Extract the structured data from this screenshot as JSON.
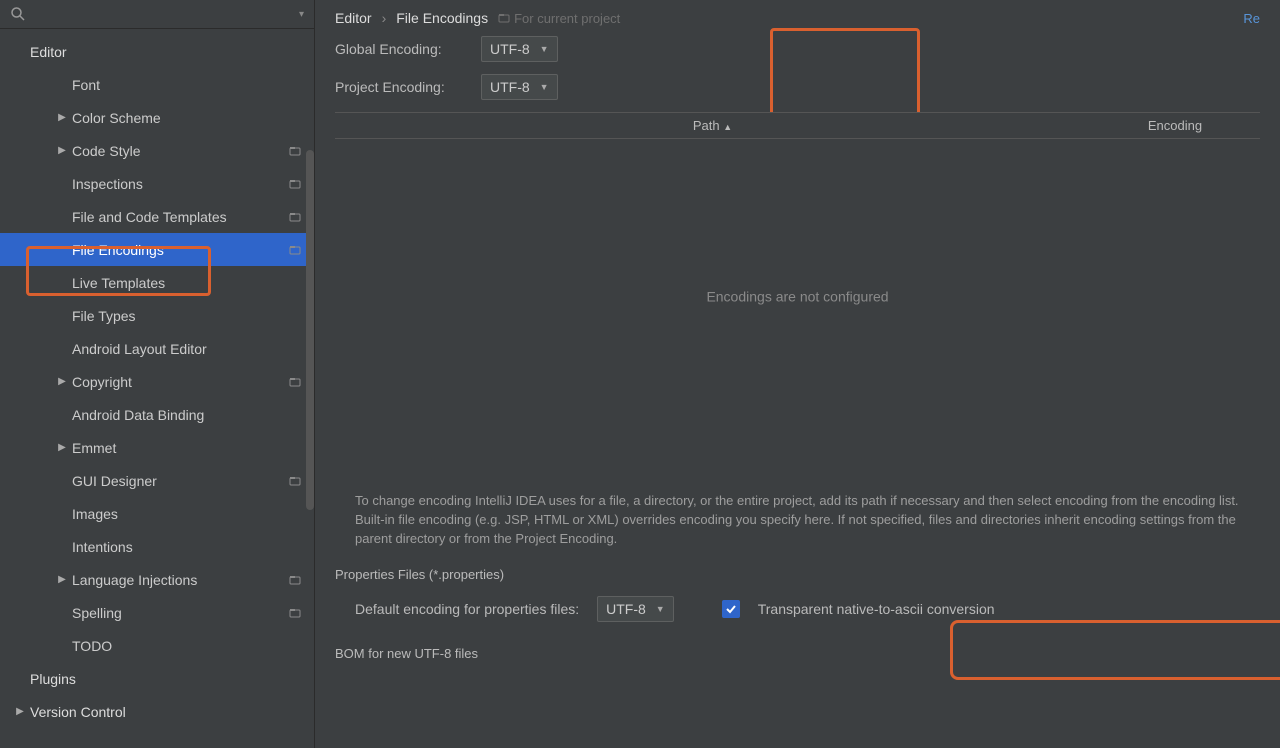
{
  "search": {
    "placeholder": ""
  },
  "sidebar": {
    "items": [
      {
        "label": "Editor",
        "depth": 0,
        "expander": "",
        "selected": false,
        "badge": false
      },
      {
        "label": "Font",
        "depth": 2,
        "expander": "",
        "selected": false,
        "badge": false
      },
      {
        "label": "Color Scheme",
        "depth": 2,
        "expander": "▶",
        "selected": false,
        "badge": false
      },
      {
        "label": "Code Style",
        "depth": 2,
        "expander": "▶",
        "selected": false,
        "badge": true
      },
      {
        "label": "Inspections",
        "depth": 2,
        "expander": "",
        "selected": false,
        "badge": true
      },
      {
        "label": "File and Code Templates",
        "depth": 2,
        "expander": "",
        "selected": false,
        "badge": true
      },
      {
        "label": "File Encodings",
        "depth": 2,
        "expander": "",
        "selected": true,
        "badge": true
      },
      {
        "label": "Live Templates",
        "depth": 2,
        "expander": "",
        "selected": false,
        "badge": false
      },
      {
        "label": "File Types",
        "depth": 2,
        "expander": "",
        "selected": false,
        "badge": false
      },
      {
        "label": "Android Layout Editor",
        "depth": 2,
        "expander": "",
        "selected": false,
        "badge": false
      },
      {
        "label": "Copyright",
        "depth": 2,
        "expander": "▶",
        "selected": false,
        "badge": true
      },
      {
        "label": "Android Data Binding",
        "depth": 2,
        "expander": "",
        "selected": false,
        "badge": false
      },
      {
        "label": "Emmet",
        "depth": 2,
        "expander": "▶",
        "selected": false,
        "badge": false
      },
      {
        "label": "GUI Designer",
        "depth": 2,
        "expander": "",
        "selected": false,
        "badge": true
      },
      {
        "label": "Images",
        "depth": 2,
        "expander": "",
        "selected": false,
        "badge": false
      },
      {
        "label": "Intentions",
        "depth": 2,
        "expander": "",
        "selected": false,
        "badge": false
      },
      {
        "label": "Language Injections",
        "depth": 2,
        "expander": "▶",
        "selected": false,
        "badge": true
      },
      {
        "label": "Spelling",
        "depth": 2,
        "expander": "",
        "selected": false,
        "badge": true
      },
      {
        "label": "TODO",
        "depth": 2,
        "expander": "",
        "selected": false,
        "badge": false
      },
      {
        "label": "Plugins",
        "depth": 0,
        "expander": "",
        "selected": false,
        "badge": false
      },
      {
        "label": "Version Control",
        "depth": 0,
        "expander": "▶",
        "selected": false,
        "badge": false
      }
    ]
  },
  "breadcrumb": {
    "a": "Editor",
    "b": "File Encodings",
    "hint": "For current project",
    "reset": "Re"
  },
  "form": {
    "global_label": "Global Encoding:",
    "global_value": "UTF-8",
    "project_label": "Project Encoding:",
    "project_value": "UTF-8"
  },
  "table": {
    "path_header": "Path",
    "encoding_header": "Encoding",
    "empty_text": "Encodings are not configured"
  },
  "help": "To change encoding IntelliJ IDEA uses for a file, a directory, or the entire project, add its path if necessary and then select encoding from the encoding list. Built-in file encoding (e.g. JSP, HTML or XML) overrides encoding you specify here. If not specified, files and directories inherit encoding settings from the parent directory or from the Project Encoding.",
  "properties": {
    "section": "Properties Files (*.properties)",
    "label": "Default encoding for properties files:",
    "value": "UTF-8",
    "checkbox_label": "Transparent native-to-ascii conversion"
  },
  "bom": {
    "section": "BOM for new UTF-8 files"
  }
}
